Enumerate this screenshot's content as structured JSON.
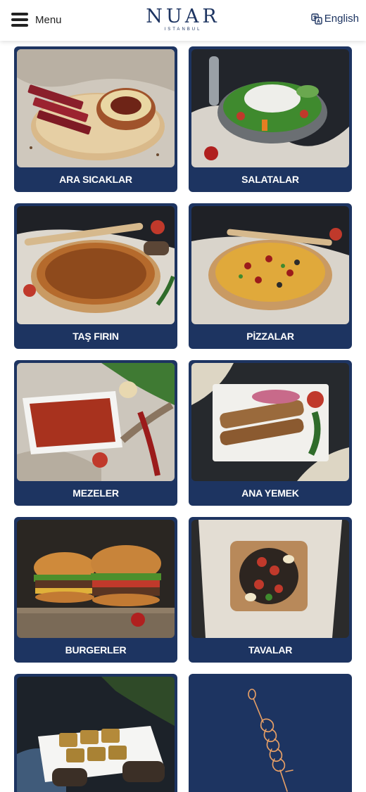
{
  "header": {
    "menu_label": "Menu",
    "logo_text": "NUAR",
    "logo_subtext": "ISTANBUL",
    "language_label": "English"
  },
  "categories": [
    {
      "label": "ARA SICAKLAR",
      "image": "ara-sicaklar-photo"
    },
    {
      "label": "SALATALAR",
      "image": "salatalar-photo"
    },
    {
      "label": "TAŞ FIRIN",
      "image": "tas-firin-photo"
    },
    {
      "label": "PİZZALAR",
      "image": "pizzalar-photo"
    },
    {
      "label": "MEZELER",
      "image": "mezeler-photo"
    },
    {
      "label": "ANA YEMEK",
      "image": "ana-yemek-photo"
    },
    {
      "label": "BURGERLER",
      "image": "burgerler-photo"
    },
    {
      "label": "TAVALAR",
      "image": "tavalar-photo"
    },
    {
      "label": "",
      "image": "baklava-photo"
    }
  ],
  "colors": {
    "brand_navy": "#1d3461",
    "accent_orange": "#e8a066"
  }
}
